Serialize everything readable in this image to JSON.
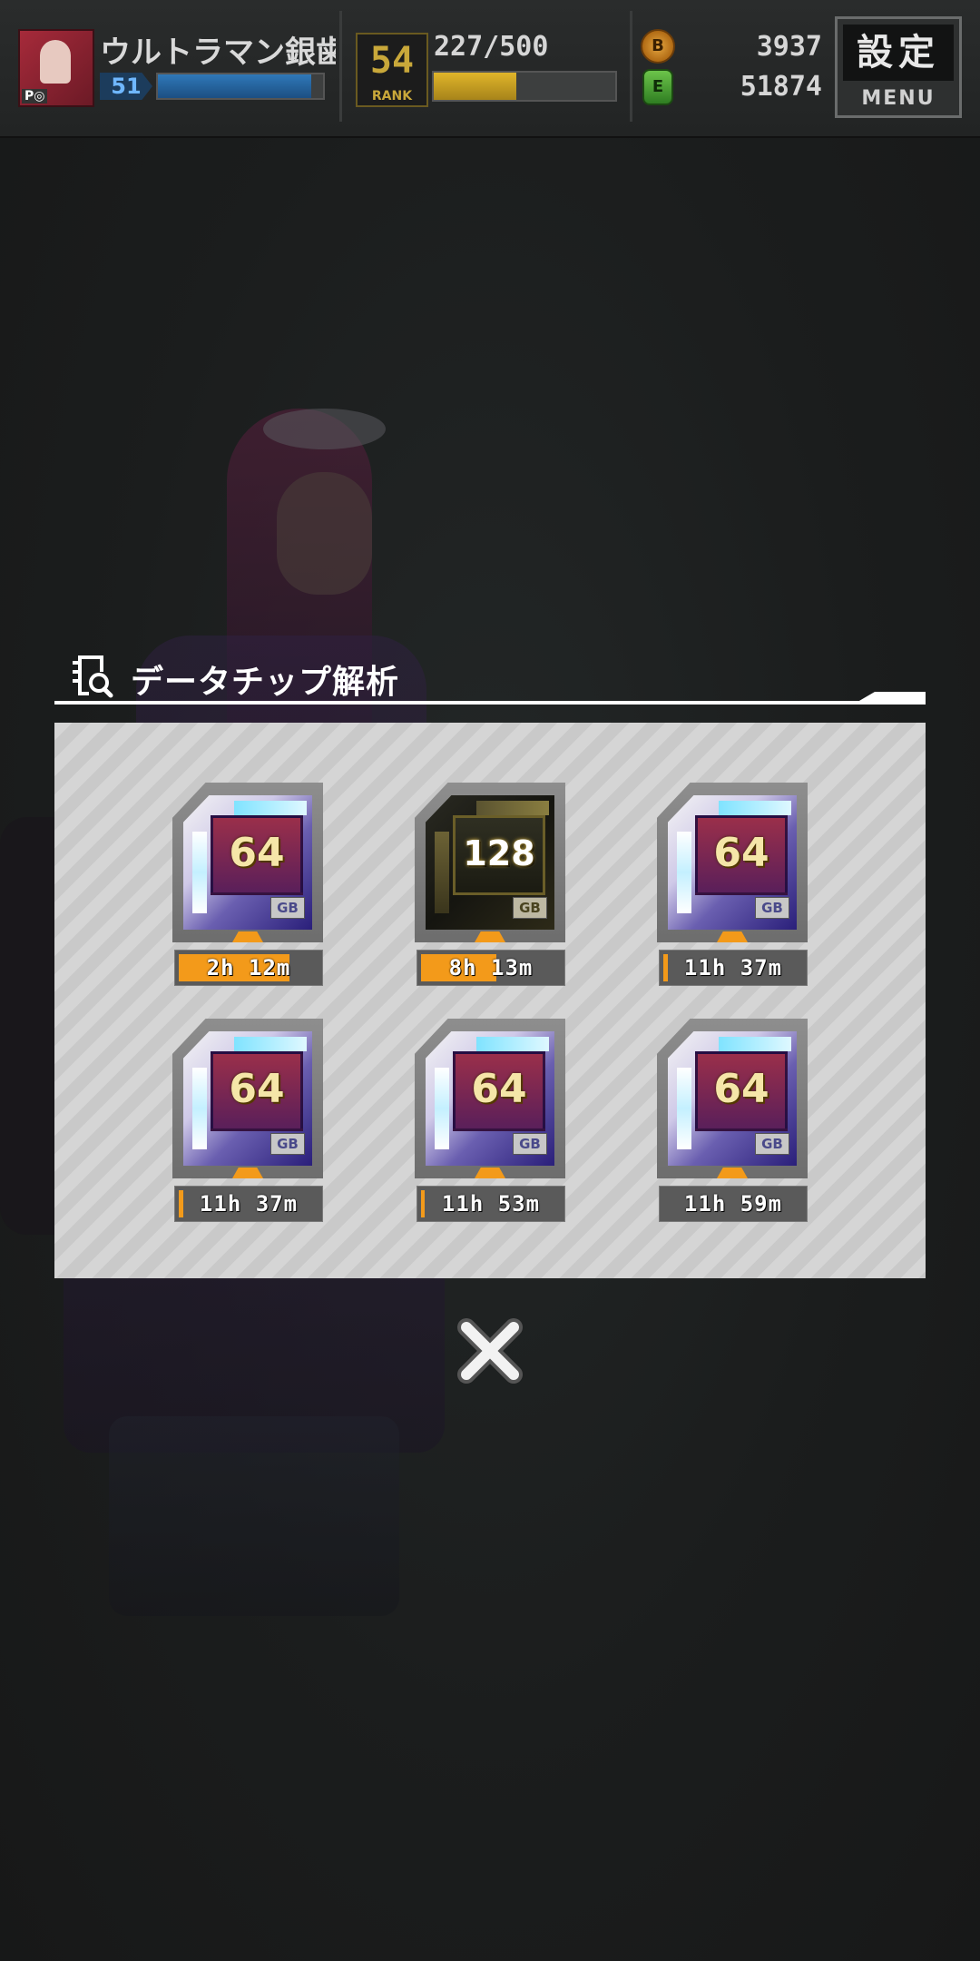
{
  "header": {
    "player_name": "ウルトラマン銀歯",
    "avatar_tag": "P◎",
    "level": "51",
    "level_progress": 0.93,
    "rank_number": "54",
    "rank_word": "RANK",
    "stamina": "227/500",
    "stamina_progress": 0.454,
    "coin_icon": "coin-b-icon",
    "coin_icon_letter": "B",
    "coins": "3937",
    "energy_icon": "energy-e-icon",
    "energy_icon_letter": "E",
    "energy": "51874",
    "menu_kanji": "設定",
    "menu_label": "MENU"
  },
  "dialog": {
    "title": "データチップ解析",
    "title_icon": "chip-search-icon",
    "close_icon": "close-x-icon",
    "chips": [
      {
        "capacity": "64",
        "unit": "GB",
        "style": "silver",
        "timer": "2h 12m",
        "progress": 0.78
      },
      {
        "capacity": "128",
        "unit": "GB",
        "style": "gold",
        "timer": "8h 13m",
        "progress": 0.53
      },
      {
        "capacity": "64",
        "unit": "GB",
        "style": "silver",
        "timer": "11h 37m",
        "progress": 0.03
      },
      {
        "capacity": "64",
        "unit": "GB",
        "style": "silver",
        "timer": "11h 37m",
        "progress": 0.03
      },
      {
        "capacity": "64",
        "unit": "GB",
        "style": "silver",
        "timer": "11h 53m",
        "progress": 0.01
      },
      {
        "capacity": "64",
        "unit": "GB",
        "style": "silver",
        "timer": "11h 59m",
        "progress": 0.0
      }
    ]
  },
  "colors": {
    "accent_orange": "#f39a1a",
    "level_blue": "#2f78b8",
    "stamina_yellow": "#e0b52a"
  }
}
